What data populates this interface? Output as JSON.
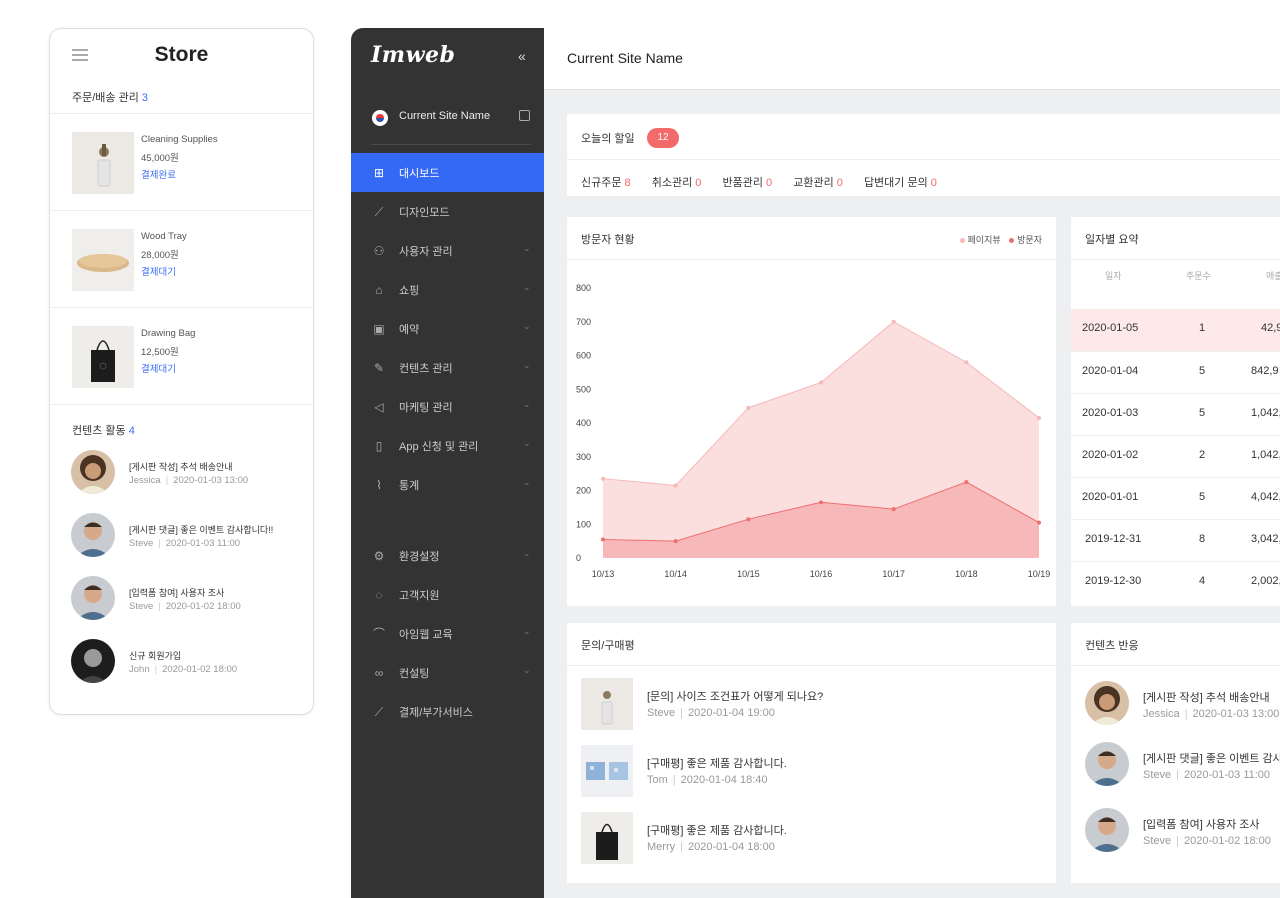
{
  "mobile": {
    "title": "Store",
    "orders_label": "주문/배송 관리",
    "orders_count": "3",
    "products": [
      {
        "name": "Cleaning Supplies",
        "price": "45,000원",
        "status": "결제완료"
      },
      {
        "name": "Wood Tray",
        "price": "28,000원",
        "status": "결제대기"
      },
      {
        "name": "Drawing Bag",
        "price": "12,500원",
        "status": "결제대기"
      }
    ],
    "activity_label": "컨텐츠 활동",
    "activity_count": "4",
    "activities": [
      {
        "text": "[게시판 작성] 추석 배송안내",
        "user": "Jessica",
        "time": "2020-01-03 13:00"
      },
      {
        "text": "[게시판 댓글] 좋은 이벤트 감사합니다!!",
        "user": "Steve",
        "time": "2020-01-03 11:00"
      },
      {
        "text": "[입력폼 참여] 사용자 조사",
        "user": "Steve",
        "time": "2020-01-02 18:00"
      },
      {
        "text": "신규 회원가입",
        "user": "John",
        "time": "2020-01-02 18:00"
      }
    ]
  },
  "sidebar": {
    "logo": "Imweb",
    "collapse_icon": "«",
    "site_name": "Current Site Name",
    "items": [
      {
        "label": "대시보드",
        "icon": "⊞",
        "active": true,
        "chevron": false
      },
      {
        "label": "디자인모드",
        "icon": "⟋",
        "active": false,
        "chevron": false
      },
      {
        "label": "사용자 관리",
        "icon": "⚇",
        "active": false,
        "chevron": true
      },
      {
        "label": "쇼핑",
        "icon": "⌂",
        "active": false,
        "chevron": true
      },
      {
        "label": "예약",
        "icon": "▣",
        "active": false,
        "chevron": true
      },
      {
        "label": "컨텐츠 관리",
        "icon": "✎",
        "active": false,
        "chevron": true
      },
      {
        "label": "마케팅 관리",
        "icon": "◁",
        "active": false,
        "chevron": true
      },
      {
        "label": "App 신청 및 관리",
        "icon": "▯",
        "active": false,
        "chevron": true
      },
      {
        "label": "통계",
        "icon": "⌇",
        "active": false,
        "chevron": true
      }
    ],
    "items2": [
      {
        "label": "환경설정",
        "icon": "⚙",
        "chevron": true
      },
      {
        "label": "고객지원",
        "icon": "◌",
        "chevron": false
      },
      {
        "label": "아임웹 교육",
        "icon": "⌒",
        "chevron": true
      },
      {
        "label": "컨설팅",
        "icon": "∞",
        "chevron": true
      },
      {
        "label": "결제/부가서비스",
        "icon": "⟋",
        "chevron": false
      }
    ]
  },
  "topbar": {
    "title": "Current Site Name"
  },
  "today": {
    "label": "오늘의 할일",
    "badge": "12",
    "stats": [
      {
        "label": "신규주문",
        "value": "8"
      },
      {
        "label": "취소관리",
        "value": "0"
      },
      {
        "label": "반품관리",
        "value": "0"
      },
      {
        "label": "교환관리",
        "value": "0"
      },
      {
        "label": "답변대기 문의",
        "value": "0"
      }
    ]
  },
  "visitors": {
    "title": "방문자 현황",
    "legend_pageview": "페이지뷰",
    "legend_visitor": "방문자"
  },
  "chart_data": {
    "type": "area",
    "x": [
      "10/13",
      "10/14",
      "10/15",
      "10/16",
      "10/17",
      "10/18",
      "10/19"
    ],
    "ylim": [
      0,
      800
    ],
    "yticks": [
      0,
      100,
      200,
      300,
      400,
      500,
      600,
      700,
      800
    ],
    "series": [
      {
        "name": "페이지뷰",
        "color": "#f6b8b8",
        "values": [
          235,
          215,
          445,
          520,
          700,
          580,
          415
        ]
      },
      {
        "name": "방문자",
        "color": "#ee6f6f",
        "values": [
          55,
          50,
          115,
          165,
          145,
          225,
          105
        ]
      }
    ]
  },
  "daily": {
    "title": "일자별 요약",
    "col_date": "일자",
    "col_orders": "주문수",
    "col_sales": "매출",
    "rows": [
      {
        "date": "2020-01-05",
        "orders": "1",
        "sales": "42,9"
      },
      {
        "date": "2020-01-04",
        "orders": "5",
        "sales": "842,9"
      },
      {
        "date": "2020-01-03",
        "orders": "5",
        "sales": "1,042,"
      },
      {
        "date": "2020-01-02",
        "orders": "2",
        "sales": "1,042,"
      },
      {
        "date": "2020-01-01",
        "orders": "5",
        "sales": "4,042,"
      },
      {
        "date": "2019-12-31",
        "orders": "8",
        "sales": "3,042,"
      },
      {
        "date": "2019-12-30",
        "orders": "4",
        "sales": "2,002,"
      }
    ]
  },
  "inquiry": {
    "title": "문의/구매평",
    "items": [
      {
        "text": "[문의] 사이즈 조건표가 어떻게 되나요?",
        "user": "Steve",
        "time": "2020-01-04 19:00"
      },
      {
        "text": "[구매평] 좋은 제품 감사합니다.",
        "user": "Tom",
        "time": "2020-01-04 18:40"
      },
      {
        "text": "[구매평] 좋은 제품 감사합니다.",
        "user": "Merry",
        "time": "2020-01-04 18:00"
      }
    ]
  },
  "content": {
    "title": "컨텐츠 반응",
    "items": [
      {
        "text": "[게시판 작성] 추석 배송안내",
        "user": "Jessica",
        "time": "2020-01-03 13:00"
      },
      {
        "text": "[게시판 댓글] 좋은 이벤트 감사합니다!!",
        "user": "Steve",
        "time": "2020-01-03 11:00"
      },
      {
        "text": "[입력폼 참여] 사용자 조사",
        "user": "Steve",
        "time": "2020-01-02 18:00"
      }
    ]
  }
}
